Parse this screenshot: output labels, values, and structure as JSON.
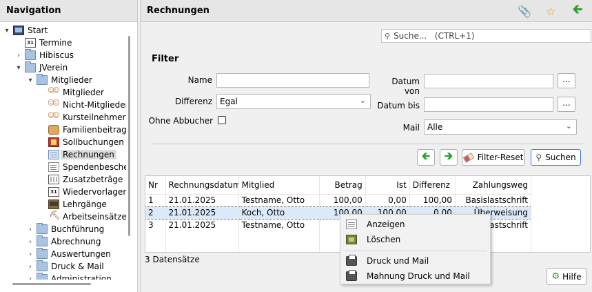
{
  "navigation": {
    "title": "Navigation",
    "items": [
      {
        "label": "Start",
        "icon": "computer-icon",
        "toggle": "▾"
      },
      {
        "label": "Termine",
        "icon": "calendar-icon",
        "badge": "31"
      },
      {
        "label": "Hibiscus",
        "icon": "folder-icon",
        "toggle": "›"
      },
      {
        "label": "JVerein",
        "icon": "folder-icon",
        "toggle": "▾"
      },
      {
        "label": "Mitglieder",
        "icon": "folder-icon",
        "toggle": "▾"
      },
      {
        "label": "Mitglieder",
        "icon": "members-icon"
      },
      {
        "label": "Nicht-Mitglieder",
        "icon": "non-members-icon"
      },
      {
        "label": "Kursteilnehmer",
        "icon": "participants-icon"
      },
      {
        "label": "Familienbeitrag",
        "icon": "family-fee-icon"
      },
      {
        "label": "Sollbuchungen",
        "icon": "ledger-icon"
      },
      {
        "label": "Rechnungen",
        "icon": "invoice-icon"
      },
      {
        "label": "Spendenbescheinigungen",
        "icon": "donation-receipt-icon"
      },
      {
        "label": "Zusatzbeträge",
        "icon": "calculator-icon"
      },
      {
        "label": "Wiedervorlagen",
        "icon": "calendar-icon",
        "badge": "31"
      },
      {
        "label": "Lehrgänge",
        "icon": "courses-icon"
      },
      {
        "label": "Arbeitseinsätze",
        "icon": "work-assignment-icon"
      },
      {
        "label": "Buchführung",
        "icon": "folder-icon",
        "toggle": "›"
      },
      {
        "label": "Abrechnung",
        "icon": "folder-icon",
        "toggle": "›"
      },
      {
        "label": "Auswertungen",
        "icon": "folder-icon",
        "toggle": "›"
      },
      {
        "label": "Druck & Mail",
        "icon": "folder-icon",
        "toggle": "›"
      },
      {
        "label": "Administration",
        "icon": "folder-icon",
        "toggle": "›"
      }
    ]
  },
  "main": {
    "title": "Rechnungen",
    "search": {
      "placeholder": "Suche...   (CTRL+1)",
      "icon": "search-icon"
    },
    "header_icons": [
      "attachment-icon",
      "star-icon",
      "back-arrow-icon"
    ]
  },
  "filter": {
    "title": "Filter",
    "name_label": "Name",
    "name_value": "",
    "differenz_label": "Differenz",
    "differenz_value": "Egal",
    "ohne_abbucher_label": "Ohne Abbucher",
    "ohne_abbucher_checked": false,
    "datum_von_label": "Datum von",
    "datum_von_value": "",
    "datum_bis_label": "Datum bis",
    "datum_bis_value": "",
    "mail_label": "Mail",
    "mail_value": "Alle",
    "dots": "...",
    "reset_label": "Filter-Reset",
    "search_label": "Suchen"
  },
  "table": {
    "columns": [
      "Nr",
      "Rechnungsdatum",
      "Mitglied",
      "Betrag",
      "Ist",
      "Differenz",
      "Zahlungsweg"
    ],
    "rows": [
      {
        "nr": "1",
        "datum": "21.01.2025",
        "mitglied": "Testname, Otto",
        "betrag": "100,00",
        "ist": "0,00",
        "differenz": "100,00",
        "zahlungsweg": "Basislastschrift"
      },
      {
        "nr": "2",
        "datum": "21.01.2025",
        "mitglied": "Koch, Otto",
        "betrag": "100,00",
        "ist": "100,00",
        "differenz": "0,00",
        "zahlungsweg": "Überweisung"
      },
      {
        "nr": "3",
        "datum": "21.01.2025",
        "mitglied": "Testname, Otto",
        "betrag": "1",
        "ist": "",
        "differenz": "",
        "zahlungsweg": "slastschrift"
      }
    ],
    "selected_row": 1,
    "count_text": "3 Datensätze"
  },
  "context_menu": {
    "items": [
      {
        "label": "Anzeigen",
        "icon": "show-icon"
      },
      {
        "label": "Löschen",
        "icon": "delete-icon"
      },
      {
        "label": "Druck und Mail",
        "icon": "print-icon"
      },
      {
        "label": "Mahnung Druck und Mail",
        "icon": "print-icon"
      }
    ]
  },
  "help_label": "Hilfe",
  "colors": {
    "selection": "#dce9f9",
    "accent_green": "#2e9e2e",
    "focus_blue": "#3a7bd5"
  }
}
